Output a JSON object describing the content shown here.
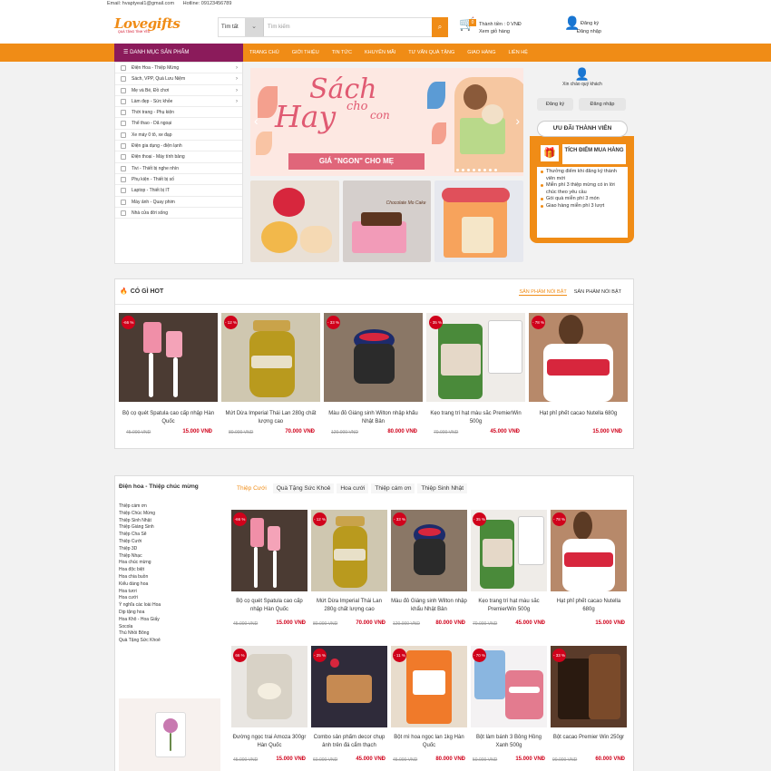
{
  "topbar": {
    "email": "Email: hvaptyeal1@gmail.com",
    "hotline": "Hotline: 09123456789"
  },
  "header": {
    "logo": "Lovegifts",
    "logo_tag": "QUÀ TẶNG TÌNH YÊU",
    "search_category": "Tìm tất",
    "search_placeholder": "Tìm kiếm",
    "cart_badge": "0",
    "cart_line1": "Thành tiền : 0 VNĐ",
    "cart_line2": "Xem giỏ hàng",
    "register": "Đăng ký",
    "login": "Đăng nhập"
  },
  "nav": {
    "category_label": "DANH MỤC SẢN PHẨM",
    "items": [
      "TRANG CHỦ",
      "GIỚI THIỆU",
      "TIN TỨC",
      "KHUYẾN MÃI",
      "TƯ VẤN QUÀ TẶNG",
      "GIAO HÀNG",
      "LIÊN HỆ"
    ]
  },
  "sidemenu": [
    {
      "label": "Điện Hoa - Thiệp Mừng",
      "arrow": true
    },
    {
      "label": "Sách, VPP, Quà Lưu Niệm",
      "arrow": true
    },
    {
      "label": "Mẹ và Bé, Đồ chơi",
      "arrow": true
    },
    {
      "label": "Làm đẹp - Sức khỏe",
      "arrow": true
    },
    {
      "label": "Thời trang - Phụ kiện",
      "arrow": false
    },
    {
      "label": "Thể thao - Dã ngoại",
      "arrow": false
    },
    {
      "label": "Xe máy 0 tô, xe đạp",
      "arrow": false
    },
    {
      "label": "Điện gia dụng - điện lạnh",
      "arrow": false
    },
    {
      "label": "Điện thoại - Máy tính bảng",
      "arrow": false
    },
    {
      "label": "Tivi - Thiết bị nghe nhìn",
      "arrow": false
    },
    {
      "label": "Phụ kiện - Thiết bị số",
      "arrow": false
    },
    {
      "label": "Laptop - Thiết bị IT",
      "arrow": false
    },
    {
      "label": "Máy ảnh - Quay phim",
      "arrow": false
    },
    {
      "label": "Nhà cửa đời sống",
      "arrow": false
    }
  ],
  "banner": {
    "l1": "Sách",
    "l2": "cho",
    "l3": "Hay",
    "l4": "con",
    "l5": "GIÁ \"NGON\" CHO MẸ"
  },
  "thumbs": {
    "cake_text": "Chocolate Mo Cake"
  },
  "rside": {
    "guest": "Xin chào quý khách",
    "register": "Đăng ký",
    "login": "Đăng nhập",
    "member_title": "ƯU ĐÃI THÀNH VIÊN",
    "points_label": "TÍCH ĐIỂM MUA HÀNG",
    "perks": [
      "Thưởng điểm khi đăng ký thành viên mới",
      "Miễn phí 3 thiệp mừng có in lời chúc theo yêu cầu",
      "Gói quà miễn phí 3 món",
      "Giao hàng miễn phí 3 lượt"
    ]
  },
  "hot": {
    "title": "CÓ GÌ HOT",
    "tab1": "SẢN PHẨM NỔI BẬT",
    "tab2": "SẢN PHẨM NỔI BẬT",
    "products": [
      {
        "sale": "-66 %",
        "name": "Bộ cọ quét Spatula cao cấp nhập Hàn Quốc",
        "old": "45.000 VNĐ",
        "new": "15.000 VNĐ"
      },
      {
        "sale": "- 12 %",
        "name": "Mứt Dừa Imperial Thái Lan 280g chất lượng cao",
        "old": "80.000 VNĐ",
        "new": "70.000 VNĐ"
      },
      {
        "sale": "- 33 %",
        "name": "Màu đỏ Giáng sinh Wilton nhập khẩu Nhật Bản",
        "old": "120.000 VNĐ",
        "new": "80.000 VNĐ"
      },
      {
        "sale": "- 35 %",
        "name": "Kẹo trang trí hạt màu sắc PremierWin 500g",
        "old": "70.000 VNĐ",
        "new": "45.000 VNĐ"
      },
      {
        "sale": "- 78 %",
        "name": "Hạt phỉ phết cacao Nutella 680g",
        "old": "",
        "new": "15.000 VNĐ"
      }
    ]
  },
  "catsec": {
    "title": "Điện hoa - Thiệp chúc mừng",
    "tabs": [
      "Thiệp Cưới",
      "Quà Tặng Sức Khoẻ",
      "Hoa cưới",
      "Thiệp cám ơn",
      "Thiệp Sinh Nhật"
    ],
    "links": [
      "Thiệp cám ơn",
      "Thiệp Chúc Mừng",
      "Thiệp Sinh Nhật",
      "Thiệp Giáng Sinh",
      "Thiệp Cha Sẽ",
      "Thiệp Cưới",
      "Thiệp 3D",
      "Thiệp Nhạc",
      "Hoa chúc mừng",
      "Hoa độc biệt",
      "Hoa chia buồn",
      "Kiểu dáng hoa",
      "Hoa tươi",
      "Hoa cưới",
      "Ý nghĩa các loài Hoa",
      "Dịp tặng hoa",
      "Hoa Khô - Hoa Giấy",
      "Socola",
      "Thú Nhồi Bông",
      "Quà Tặng Sức Khoẻ"
    ],
    "row1": [
      {
        "sale": "-66 %",
        "name": "Bộ cọ quét Spatula cao cấp nhập Hàn Quốc",
        "old": "45.000 VNĐ",
        "new": "15.000 VNĐ"
      },
      {
        "sale": "- 12 %",
        "name": "Mứt Dừa Imperial Thái Lan 280g chất lượng cao",
        "old": "80.000 VNĐ",
        "new": "70.000 VNĐ"
      },
      {
        "sale": "- 33 %",
        "name": "Màu đỏ Giáng sinh Wilton nhập khẩu Nhật Bản",
        "old": "120.000 VNĐ",
        "new": "80.000 VNĐ"
      },
      {
        "sale": "- 35 %",
        "name": "Kẹo trang trí hạt màu sắc PremierWin 500g",
        "old": "70.000 VNĐ",
        "new": "45.000 VNĐ"
      },
      {
        "sale": "- 78 %",
        "name": "Hạt phỉ phết cacao Nutella 680g",
        "old": "",
        "new": "15.000 VNĐ"
      }
    ],
    "row2": [
      {
        "sale": "66 %",
        "name": "Đường ngọc trai Amoza 300gr Hàn Quốc",
        "old": "45.000 VNĐ",
        "new": "15.000 VNĐ"
      },
      {
        "sale": "- 25 %",
        "name": "Combo sản phẩm decor chụp ảnh trên đá cẩm thạch",
        "old": "60.000 VNĐ",
        "new": "45.000 VNĐ"
      },
      {
        "sale": "- 11 %",
        "name": "Bột mì hoa ngọc lan 1kg Hàn Quốc",
        "old": "45.000 VNĐ",
        "new": "80.000 VNĐ"
      },
      {
        "sale": "- 70 %",
        "name": "Bột làm bánh 3 Bông Hồng Xanh 500g",
        "old": "50.000 VNĐ",
        "new": "15.000 VNĐ"
      },
      {
        "sale": "- 33 %",
        "name": "Bột cacao Premier Win 250gr",
        "old": "90.000 VNĐ",
        "new": "60.000 VNĐ"
      }
    ]
  },
  "colors": {
    "accent": "#f08c16",
    "sale": "#d0021b",
    "category_btn": "#8b1b5b"
  }
}
